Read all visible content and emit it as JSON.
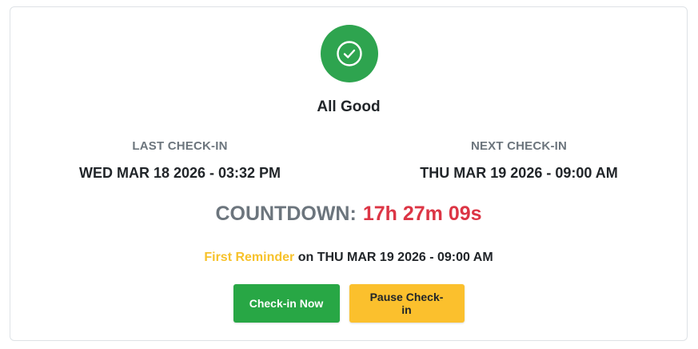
{
  "status": {
    "icon": "check-circle-icon",
    "title": "All Good",
    "color": "#2ea44f"
  },
  "last_checkin": {
    "label": "LAST CHECK-IN",
    "value": "WED MAR 18 2026 - 03:32 PM"
  },
  "next_checkin": {
    "label": "NEXT CHECK-IN",
    "value": "THU MAR 19 2026 - 09:00 AM"
  },
  "countdown": {
    "label": "COUNTDOWN:",
    "value": "17h 27m 09s",
    "color": "#dc3545"
  },
  "reminder": {
    "name": "First Reminder",
    "connector": "on",
    "datetime": "THU MAR 19 2026 - 09:00 AM",
    "color": "#f7c22b"
  },
  "actions": {
    "checkin_label": "Check-in Now",
    "pause_label": "Pause Check-in"
  }
}
